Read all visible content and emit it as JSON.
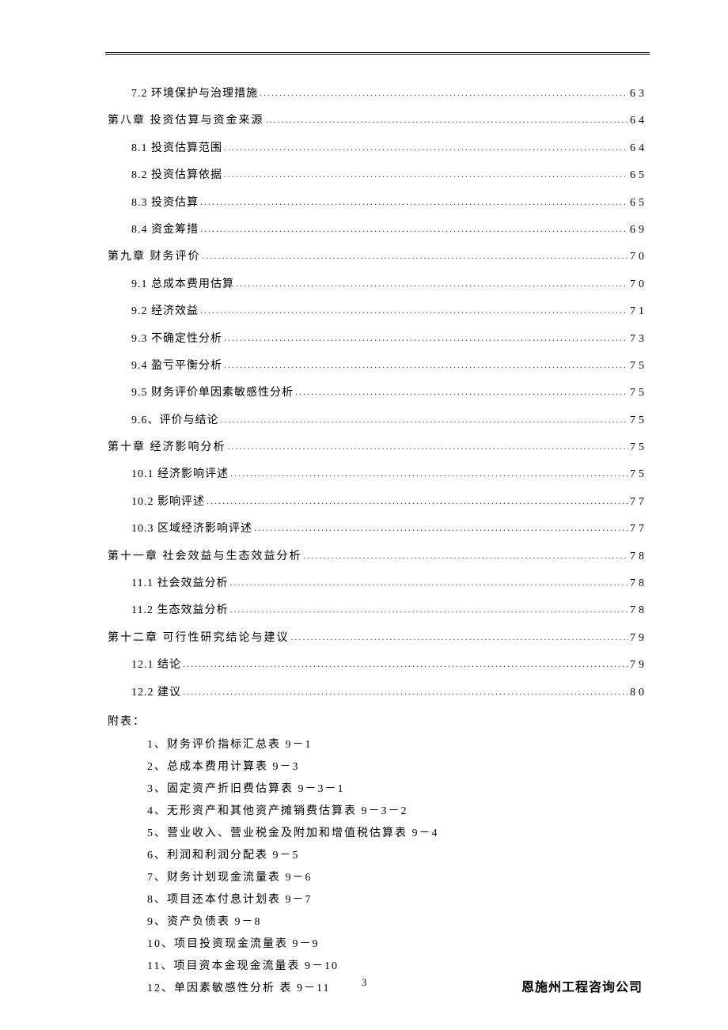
{
  "toc": [
    {
      "level": "sub",
      "label": "7.2 环境保护与治理措施",
      "page": "63"
    },
    {
      "level": "chap",
      "label": "第八章   投资估算与资金来源",
      "page": "64"
    },
    {
      "level": "sub",
      "label": "8.1 投资估算范围",
      "page": "64"
    },
    {
      "level": "sub",
      "label": "8.2 投资估算依据",
      "page": "65"
    },
    {
      "level": "sub",
      "label": "8.3 投资估算",
      "page": "65"
    },
    {
      "level": "sub",
      "label": "8.4 资金筹措",
      "page": "69"
    },
    {
      "level": "chap",
      "label": "第九章   财务评价",
      "page": "70"
    },
    {
      "level": "sub",
      "label": "9.1  总成本费用估算",
      "page": "70"
    },
    {
      "level": "sub",
      "label": "9.2 经济效益",
      "page": "71"
    },
    {
      "level": "sub",
      "label": "9.3   不确定性分析",
      "page": "73"
    },
    {
      "level": "sub",
      "label": "9.4  盈亏平衡分析",
      "page": "75"
    },
    {
      "level": "sub",
      "label": "9.5  财务评价单因素敏感性分析",
      "page": "75"
    },
    {
      "level": "sub",
      "label": "9.6、评价与结论",
      "page": "75"
    },
    {
      "level": "chap",
      "label": "第十章   经济影响分析",
      "page": "75"
    },
    {
      "level": "sub",
      "label": "10.1 经济影响评述",
      "page": "75"
    },
    {
      "level": "sub",
      "label": "10.2 影响评述",
      "page": "77"
    },
    {
      "level": "sub",
      "label": "10.3 区域经济影响评述",
      "page": "77"
    },
    {
      "level": "chap",
      "label": "第十一章   社会效益与生态效益分析",
      "page": "78"
    },
    {
      "level": "sub",
      "label": "11.1 社会效益分析",
      "page": "78"
    },
    {
      "level": "sub",
      "label": "11.2 生态效益分析",
      "page": "78"
    },
    {
      "level": "chap",
      "label": "第十二章   可行性研究结论与建议",
      "page": "79"
    },
    {
      "level": "sub",
      "label": "12.1 结论",
      "page": "79"
    },
    {
      "level": "sub",
      "label": "12.2 建议",
      "page": "80"
    }
  ],
  "appendix": {
    "title": "附表：",
    "items": [
      "1、财务评价指标汇总表  9－1",
      "2、总成本费用计算表  9－3",
      "3、固定资产折旧费估算表  9－3－1",
      "4、无形资产和其他资产摊销费估算表  9－3－2",
      "5、营业收入、营业税金及附加和增值税估算表  9－4",
      "6、利润和利润分配表  9－5",
      "7、财务计划现金流量表  9－6",
      "8、项目还本付息计划表  9－7",
      "9、资产负债表  9－8",
      "10、项目投资现金流量表 9－9",
      "11、项目资本金现金流量表 9－10",
      "12、单因素敏感性分析   表 9－11"
    ]
  },
  "footer": {
    "pageNumber": "3",
    "company": "恩施州工程咨询公司"
  }
}
